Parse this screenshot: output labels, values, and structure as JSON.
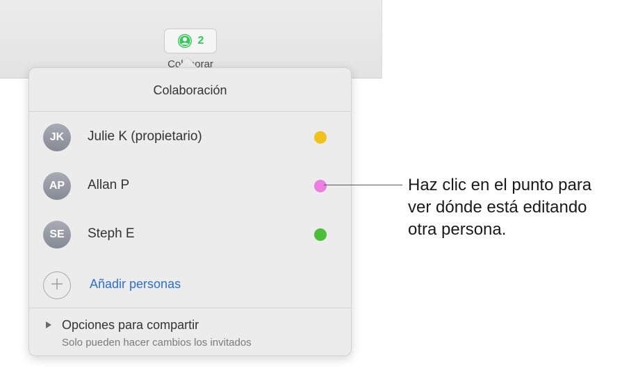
{
  "toolbar": {
    "collaborate_count": "2",
    "collaborate_label": "Colaborar",
    "collaborate_icon": "person-icon",
    "count_color": "#34c759"
  },
  "popover": {
    "title": "Colaboración",
    "participants": [
      {
        "initials": "JK",
        "name": "Julie K (propietario)",
        "dot_color": "#f0c21b"
      },
      {
        "initials": "AP",
        "name": "Allan P",
        "dot_color": "#ea7fe0"
      },
      {
        "initials": "SE",
        "name": "Steph E",
        "dot_color": "#4cbf3a"
      }
    ],
    "add_people": {
      "label": "Añadir personas",
      "icon": "plus-icon",
      "color": "#2a6ed8"
    },
    "sharing": {
      "title": "Opciones para compartir",
      "subtitle": "Solo pueden hacer cambios los invitados",
      "icon": "disclosure-triangle-icon"
    }
  },
  "callout": {
    "lines": [
      "Haz clic en el punto para",
      "ver dónde está editando",
      "otra persona."
    ]
  }
}
